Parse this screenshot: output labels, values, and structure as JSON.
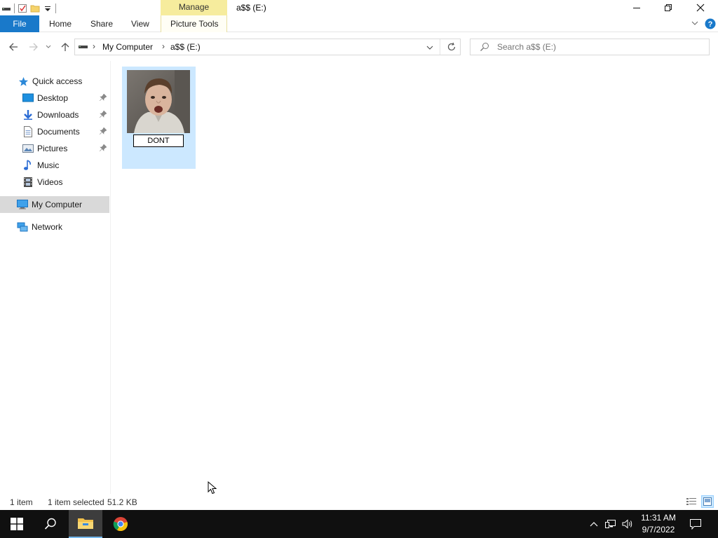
{
  "window": {
    "title": "a$$ (E:)",
    "contextual_tab_group": "Manage"
  },
  "ribbon": {
    "tabs": [
      "File",
      "Home",
      "Share",
      "View",
      "Picture Tools"
    ]
  },
  "address": {
    "breadcrumb": [
      "My Computer",
      "a$$ (E:)"
    ],
    "search_placeholder": "Search a$$ (E:)"
  },
  "nav": {
    "quick_access": "Quick access",
    "items": [
      {
        "label": "Desktop",
        "icon": "desktop-icon",
        "pinned": true
      },
      {
        "label": "Downloads",
        "icon": "downloads-icon",
        "pinned": true
      },
      {
        "label": "Documents",
        "icon": "documents-icon",
        "pinned": true
      },
      {
        "label": "Pictures",
        "icon": "pictures-icon",
        "pinned": true
      },
      {
        "label": "Music",
        "icon": "music-icon",
        "pinned": false
      },
      {
        "label": "Videos",
        "icon": "videos-icon",
        "pinned": false
      }
    ],
    "this_pc": "My Computer",
    "network": "Network"
  },
  "content": {
    "files": [
      {
        "rename_value": "DONT",
        "selected": true,
        "renaming": true
      }
    ]
  },
  "status": {
    "item_count": "1 item",
    "selection": "1 item selected",
    "size": "51.2 KB"
  },
  "taskbar": {
    "time": "11:31 AM",
    "date": "9/7/2022"
  },
  "colors": {
    "accent": "#1979ca",
    "selection": "#cce8ff",
    "manage_tab": "#f6ec9d",
    "taskbar": "#101010"
  }
}
